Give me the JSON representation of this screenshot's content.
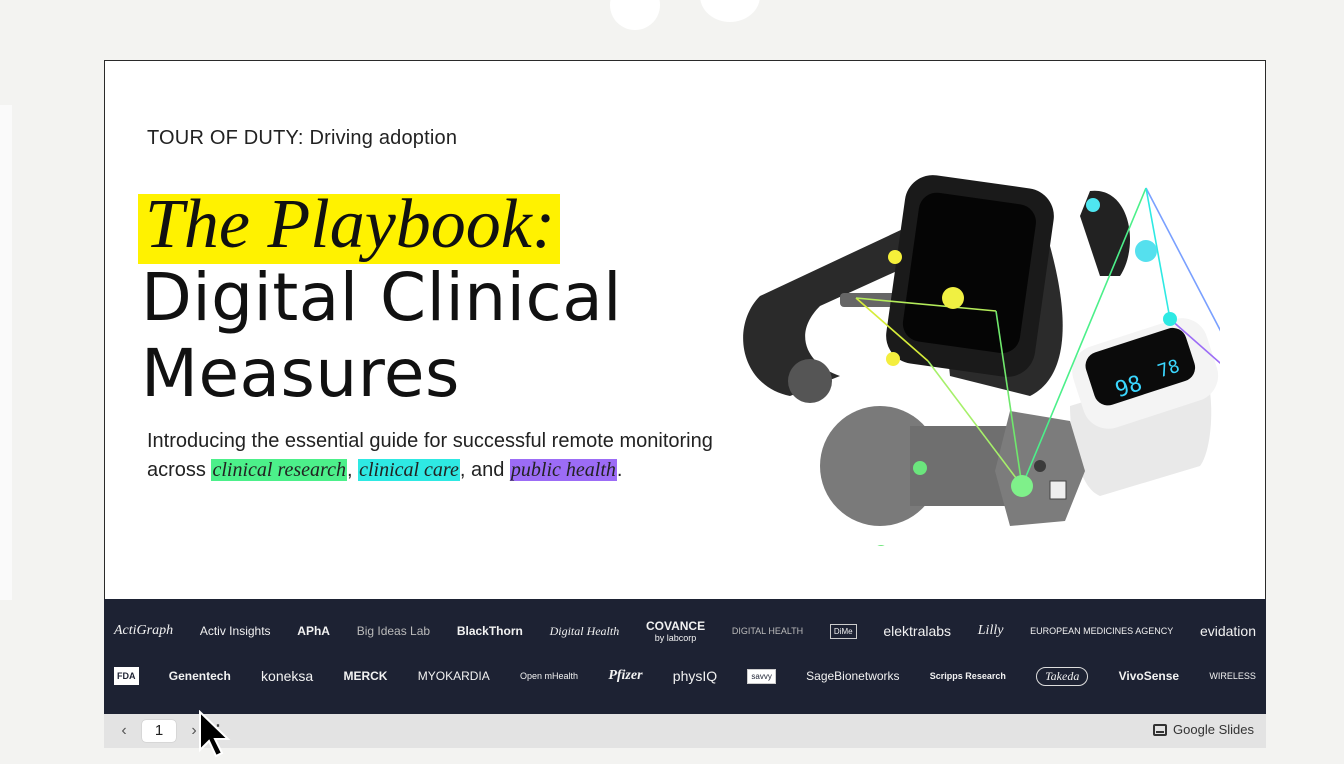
{
  "slide": {
    "kicker": "TOUR OF DUTY: Driving adoption",
    "title_italic": "The Playbook:",
    "title_line1": "Digital Clinical",
    "title_line2": "Measures",
    "intro_before": "Introducing the essential guide for successful remote monitoring across ",
    "hl_research": "clinical research",
    "sep1": ", ",
    "hl_care": "clinical care",
    "sep2": ", and ",
    "hl_public": "public health",
    "intro_end": ".",
    "device_icons": [
      "smartwatch-icon",
      "pulse-oximeter-icon",
      "wearable-patch-icon",
      "wrist-band-icon"
    ],
    "oximeter_reading_spo2": "98",
    "oximeter_reading_pr": "78"
  },
  "logos": {
    "row1": [
      "ActiGraph",
      "Activ Insights",
      "APhA",
      "Big Ideas Lab",
      "BlackThorn",
      "Digital Health",
      "COVANCE",
      "by labcorp",
      "DIGITAL HEALTH",
      "DiMe",
      "elektralabs",
      "Lilly",
      "EUROPEAN MEDICINES AGENCY",
      "evidation"
    ],
    "row2": [
      "FDA",
      "Genentech",
      "koneksa",
      "MERCK",
      "MYOKARDIA",
      "Open mHealth",
      "Pfizer",
      "physIQ",
      "savvy",
      "SageBionetworks",
      "Scripps Research",
      "Takeda",
      "VivoSense",
      "WIRELESS"
    ]
  },
  "controls": {
    "prev": "‹",
    "page": "1",
    "next": "›",
    "menu": "⋮",
    "brand": "Google Slides"
  },
  "colors": {
    "highlight_yellow": "#fff200",
    "highlight_green": "#4cf08a",
    "highlight_cyan": "#2ee9e3",
    "highlight_purple": "#9c6cf6",
    "logo_band": "#1d2233"
  }
}
